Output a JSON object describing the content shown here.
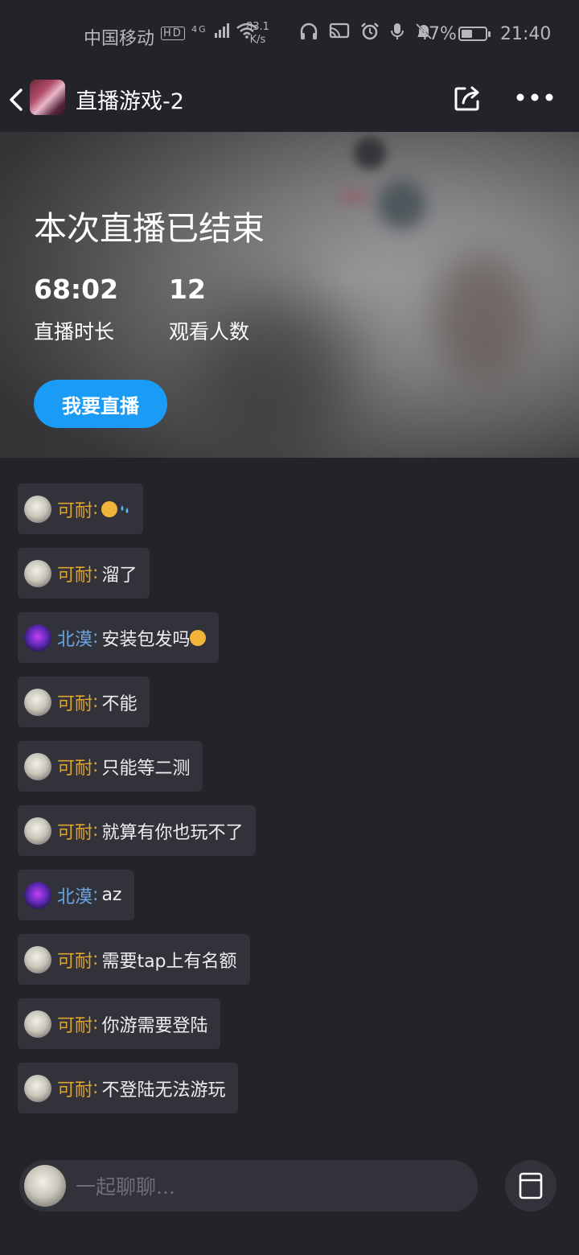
{
  "status_bar": {
    "carrier": "中国移动",
    "network_speed": "83.1",
    "network_speed_unit": "K/s",
    "battery": "47%",
    "battery_level": 0.47,
    "time": "21:40",
    "icons": [
      "hd-icon",
      "4g-icon",
      "signal-icon",
      "wifi-icon",
      "headphones-icon",
      "cast-icon",
      "alarm-icon",
      "mic-icon",
      "mute-icon"
    ]
  },
  "nav": {
    "title": "直播游戏-2",
    "back_icon": "chevron-left-icon",
    "share_icon": "share-icon",
    "more_icon": "more-icon"
  },
  "banner": {
    "ended_title": "本次直播已结束",
    "duration_value": "68:02",
    "duration_label": "直播时长",
    "viewers_value": "12",
    "viewers_label": "观看人数",
    "go_live_button": "我要直播"
  },
  "chat": {
    "separator": ":",
    "messages": [
      {
        "user": "可耐",
        "text": "",
        "emoji": [
          "smirk-emoji",
          "sweat-drops-emoji"
        ]
      },
      {
        "user": "可耐",
        "text": "溜了"
      },
      {
        "user": "北漠",
        "text": "安装包发吗",
        "emoji": [
          "smirk-emoji"
        ]
      },
      {
        "user": "可耐",
        "text": "不能"
      },
      {
        "user": "可耐",
        "text": "只能等二测"
      },
      {
        "user": "可耐",
        "text": "就算有你也玩不了"
      },
      {
        "user": "北漠",
        "text": "az"
      },
      {
        "user": "可耐",
        "text": "需要tap上有名额"
      },
      {
        "user": "可耐",
        "text": "你游需要登陆"
      },
      {
        "user": "可耐",
        "text": "不登陆无法游玩"
      }
    ]
  },
  "input": {
    "placeholder": "一起聊聊...",
    "gift_icon": "gift-box-icon"
  },
  "colors": {
    "background": "#232329",
    "bubble": "#32323a",
    "accent_blue": "#1a9bf5",
    "name_kenai": "#e0a330",
    "name_beimo": "#6aa6e8"
  }
}
